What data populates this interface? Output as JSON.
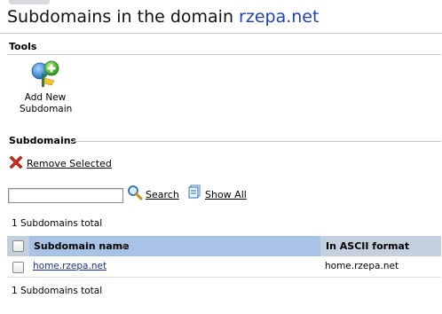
{
  "header": {
    "title_prefix": "Subdomains in the domain ",
    "title_domain": "rzepa.net"
  },
  "tools": {
    "heading": "Tools",
    "add_new_line1": "Add New",
    "add_new_line2": "Subdomain"
  },
  "subdomains": {
    "heading": "Subdomains",
    "remove_selected": "Remove Selected",
    "search_value": "",
    "search_label": "Search",
    "show_all_label": "Show All",
    "total_top": "1 Subdomains total",
    "total_bottom": "1 Subdomains total",
    "table": {
      "col_name": "Subdomain name",
      "col_ascii": "In ASCII format",
      "rows": [
        {
          "name": "home.rzepa.net",
          "ascii": "home.rzepa.net"
        }
      ]
    }
  },
  "colors": {
    "domain_text": "#1f3fb8",
    "header_bg": "#c4d0de",
    "sorted_header_bg": "#a9c3e6",
    "link": "#1a2f99"
  }
}
